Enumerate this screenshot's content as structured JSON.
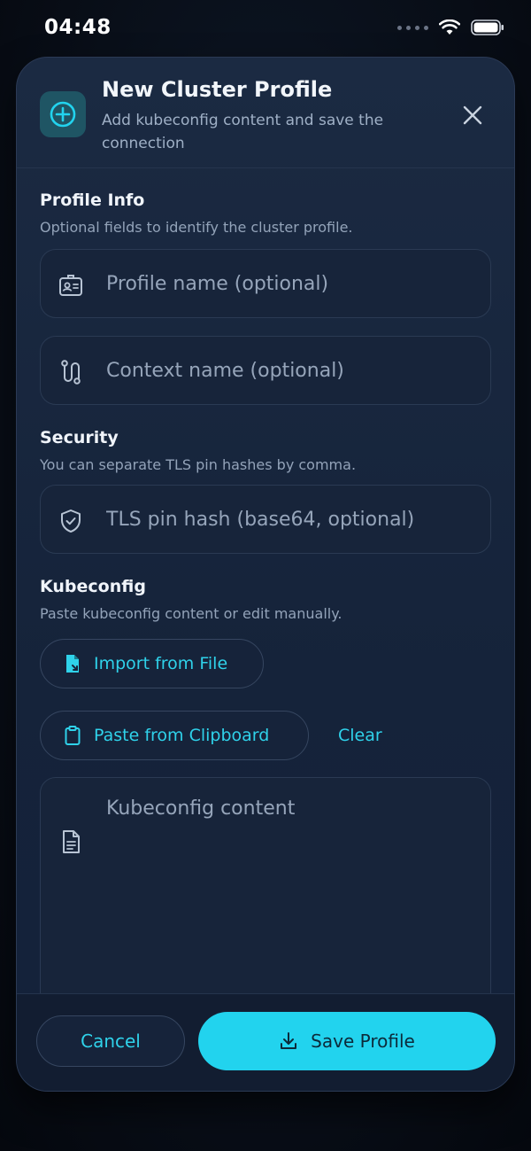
{
  "status_bar": {
    "time": "04:48"
  },
  "header": {
    "title": "New Cluster Profile",
    "subtitle": "Add kubeconfig content and save the connection",
    "icon": "plus-circle-icon",
    "close_icon": "close-icon"
  },
  "profile_info": {
    "title": "Profile Info",
    "description": "Optional fields to identify the cluster profile.",
    "profile_name": {
      "placeholder": "Profile name (optional)",
      "value": "",
      "icon": "id-card-icon"
    },
    "context_name": {
      "placeholder": "Context name (optional)",
      "value": "",
      "icon": "route-icon"
    }
  },
  "security": {
    "title": "Security",
    "description": "You can separate TLS pin hashes by comma.",
    "tls_pin": {
      "placeholder": "TLS pin hash (base64, optional)",
      "value": "",
      "icon": "shield-check-icon"
    }
  },
  "kubeconfig": {
    "title": "Kubeconfig",
    "description": "Paste kubeconfig content or edit manually.",
    "import_label": "Import from File",
    "paste_label": "Paste from Clipboard",
    "clear_label": "Clear",
    "content": {
      "placeholder": "Kubeconfig content",
      "value": "",
      "icon": "document-icon"
    }
  },
  "footer": {
    "cancel_label": "Cancel",
    "save_label": "Save Profile"
  },
  "colors": {
    "accent": "#22d3ee",
    "background": "#0a111c",
    "sheet": "#1a2940"
  }
}
